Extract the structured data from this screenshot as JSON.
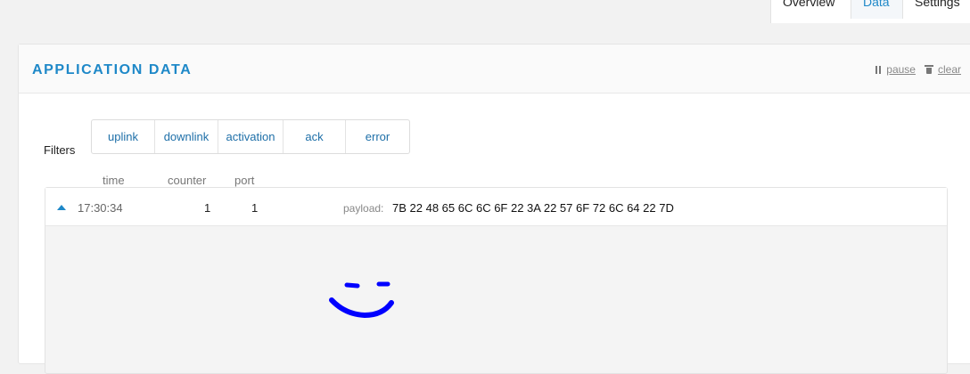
{
  "tabs": [
    {
      "label": "Overview",
      "active": false
    },
    {
      "label": "Data",
      "active": true
    },
    {
      "label": "Settings",
      "active": false
    }
  ],
  "panel": {
    "title": "APPLICATION DATA",
    "actions": {
      "pause_label": "pause",
      "clear_label": "clear"
    }
  },
  "filters": {
    "label": "Filters",
    "buttons": [
      "uplink",
      "downlink",
      "activation",
      "ack",
      "error"
    ]
  },
  "table": {
    "columns": [
      "time",
      "counter",
      "port"
    ],
    "rows": [
      {
        "time": "17:30:34",
        "counter": "1",
        "port": "1",
        "payload_label": "payload:",
        "payload": "7B 22 48 65 6C 6C 6F 22 3A 22 57 6F 72 6C 64 22 7D"
      }
    ]
  },
  "colors": {
    "accent": "#1e88c8",
    "smiley": "#0000ff"
  },
  "icons": {
    "pause": "pause-icon",
    "clear": "trash-icon",
    "expand": "caret-up-icon"
  }
}
